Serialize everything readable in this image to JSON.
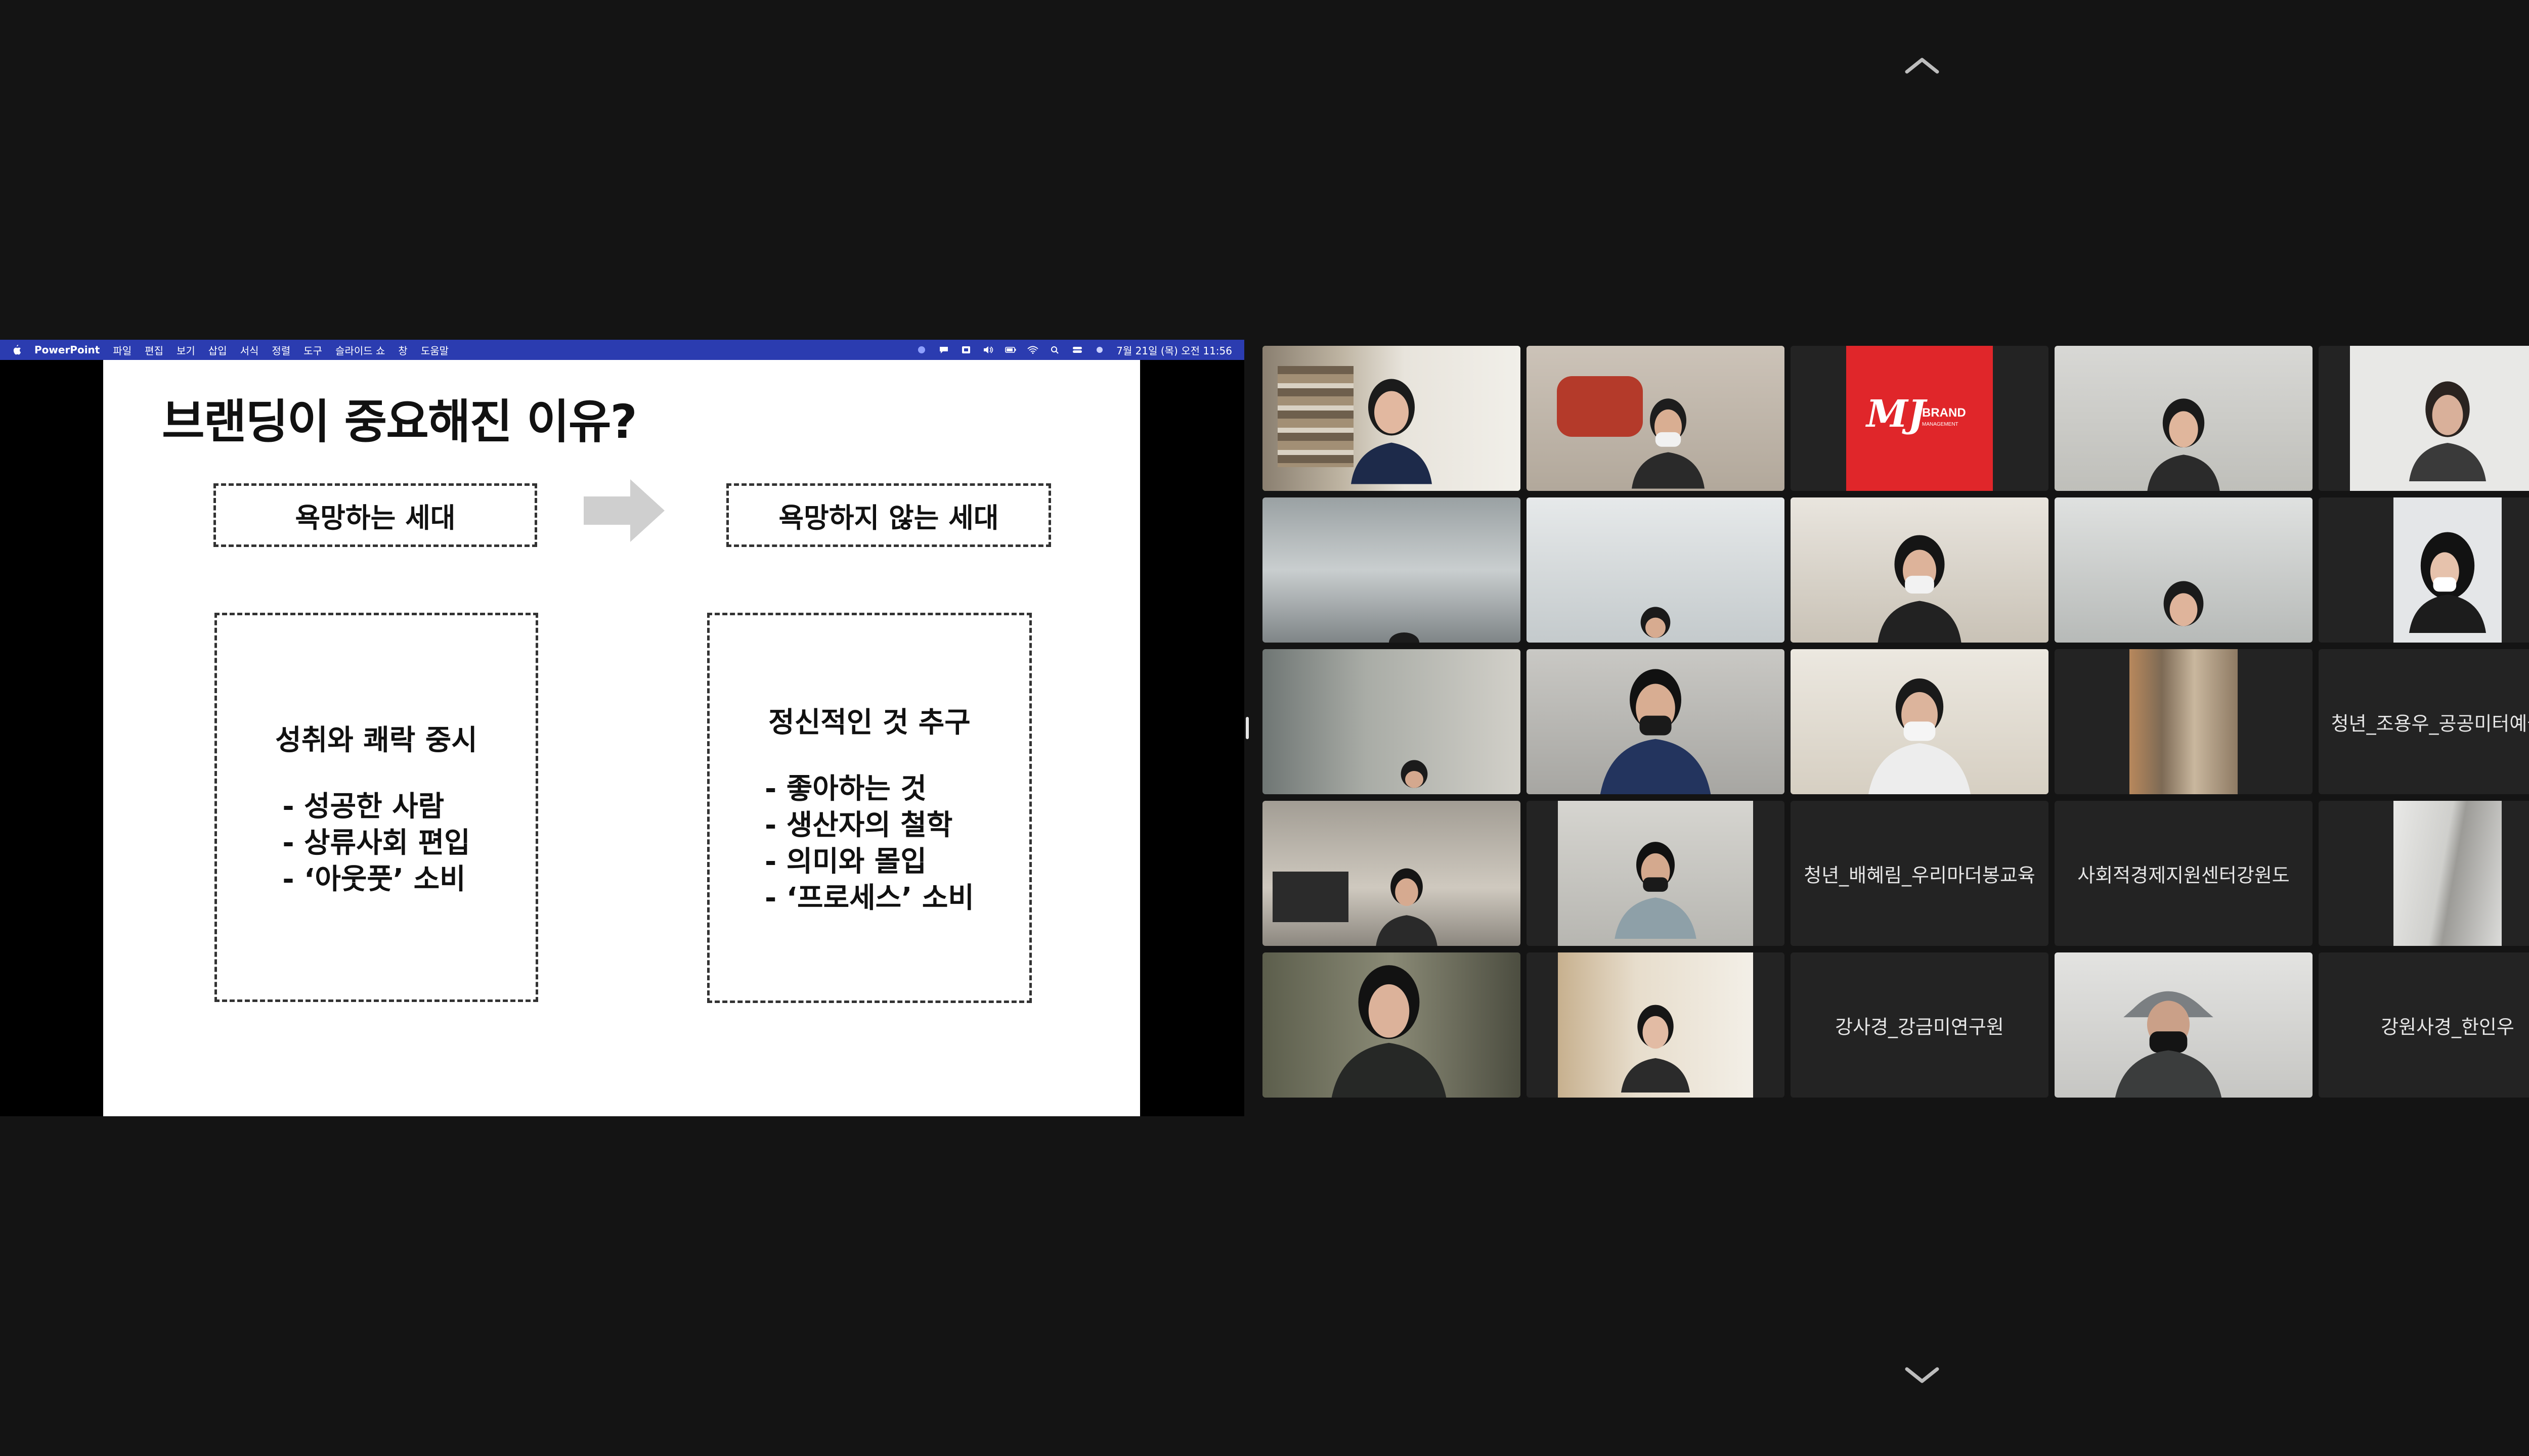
{
  "menubar": {
    "app": "PowerPoint",
    "items": [
      "파일",
      "편집",
      "보기",
      "삽입",
      "서식",
      "정렬",
      "도구",
      "슬라이드 쇼",
      "창",
      "도움말"
    ],
    "clock": "7월 21일 (목) 오전 11:56"
  },
  "slide": {
    "title": "브랜딩이 중요해진 이유?",
    "left_label": "욕망하는 세대",
    "right_label": "욕망하지 않는 세대",
    "left_box": {
      "heading": "성취와 쾌락 중시",
      "bullets": [
        "-   성공한 사람",
        "-   상류사회 편입",
        "-   ‘아웃풋’ 소비"
      ]
    },
    "right_box": {
      "heading": "정신적인 것 추구",
      "bullets": [
        "-   좋아하는 것",
        "-   생산자의 철학",
        "-   의미와 몰입",
        "-   ‘프로세스’ 소비"
      ]
    }
  },
  "logo": {
    "mark": "MJ",
    "line1": "BRAND",
    "line2": "MANAGEMENT"
  },
  "participants": [
    "청년_조용우_공공미터예술…",
    "청년_배혜림_우리마더봉교육",
    "사회적경제지원센터강원도",
    "강사경_강금미연구원",
    "강원사경_한인우"
  ],
  "colors": {
    "menubar": "#2b3cb0",
    "active_speaker": "#4cd14c",
    "logo_bg": "#e0262a"
  }
}
